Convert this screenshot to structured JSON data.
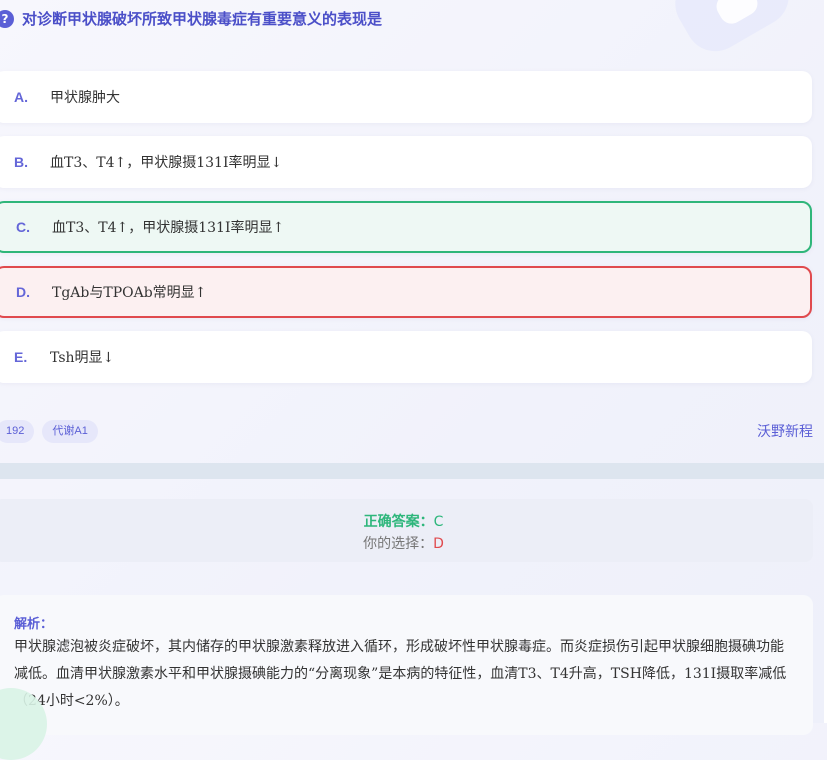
{
  "question": {
    "icon": "question-icon",
    "icon_glyph": "?",
    "text": "对诊断甲状腺破坏所致甲状腺毒症有重要意义的表现是"
  },
  "options": [
    {
      "letter": "A.",
      "text": "甲状腺肿大",
      "state": "normal"
    },
    {
      "letter": "B.",
      "text": "血T3、T4↑，甲状腺摄131I率明显↓",
      "state": "normal"
    },
    {
      "letter": "C.",
      "text": "血T3、T4↑，甲状腺摄131I率明显↑",
      "state": "correct"
    },
    {
      "letter": "D.",
      "text": "TgAb与TPOAb常明显↑",
      "state": "wrong"
    },
    {
      "letter": "E.",
      "text": "Tsh明显↓",
      "state": "normal"
    }
  ],
  "tags": [
    "192",
    "代谢A1"
  ],
  "source": "沃野新程",
  "answer": {
    "correct_label": "正确答案：",
    "correct_value": "C",
    "choice_label": "你的选择：",
    "choice_value": "D"
  },
  "analysis": {
    "title": "解析：",
    "body": "甲状腺滤泡被炎症破坏，其内储存的甲状腺激素释放进入循环，形成破坏性甲状腺毒症。而炎症损伤引起甲状腺细胞摄碘功能减低。血清甲状腺激素水平和甲状腺摄碘能力的“分离现象”是本病的特征性，血清T3、T4升高，TSH降低，131I摄取率减低（24小时<2%）。"
  },
  "colors": {
    "accent": "#5b5fd6",
    "correct": "#2fb67a",
    "wrong": "#e04a4e"
  }
}
